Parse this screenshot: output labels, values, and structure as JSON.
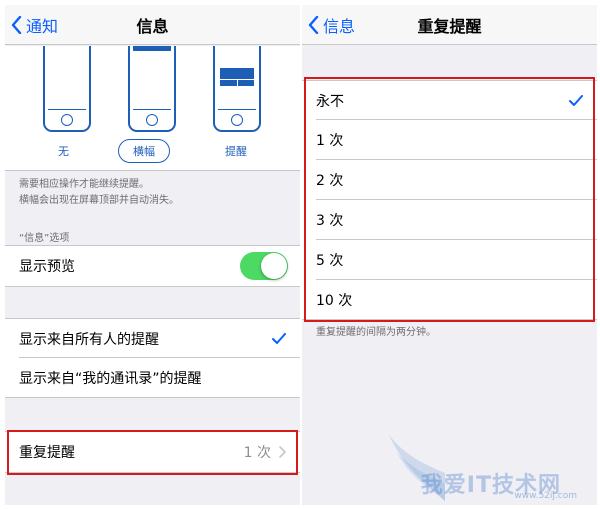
{
  "left": {
    "nav": {
      "back_label": "通知",
      "title": "信息"
    },
    "styles": [
      {
        "label": "无",
        "selected": false
      },
      {
        "label": "横幅",
        "selected": true
      },
      {
        "label": "提醒",
        "selected": false
      }
    ],
    "style_footnote_line1": "需要相应操作才能继续提醒。",
    "style_footnote_line2": "横幅会出现在屏幕顶部并自动消失。",
    "options_header": "“信息”选项",
    "show_preview": {
      "label": "显示预览",
      "enabled": true
    },
    "show_alerts_all": {
      "label": "显示来自所有人的提醒",
      "checked": true
    },
    "show_alerts_contacts": {
      "label": "显示来自“我的通讯录”的提醒",
      "checked": false
    },
    "repeat_alerts": {
      "label": "重复提醒",
      "value": "1 次"
    }
  },
  "right": {
    "nav": {
      "back_label": "信息",
      "title": "重复提醒"
    },
    "options": [
      {
        "label": "永不",
        "checked": true
      },
      {
        "label": "1 次",
        "checked": false
      },
      {
        "label": "2 次",
        "checked": false
      },
      {
        "label": "3 次",
        "checked": false
      },
      {
        "label": "5 次",
        "checked": false
      },
      {
        "label": "10 次",
        "checked": false
      }
    ],
    "footnote": "重复提醒的间隔为两分钟。"
  },
  "watermark": {
    "main": "我爱IT技术网",
    "sub": "www.52ij.com"
  },
  "colors": {
    "accent": "#0a60fe",
    "toggle_on": "#4cd964",
    "highlight": "#d41a1a",
    "illustration": "#1d5fb6"
  }
}
